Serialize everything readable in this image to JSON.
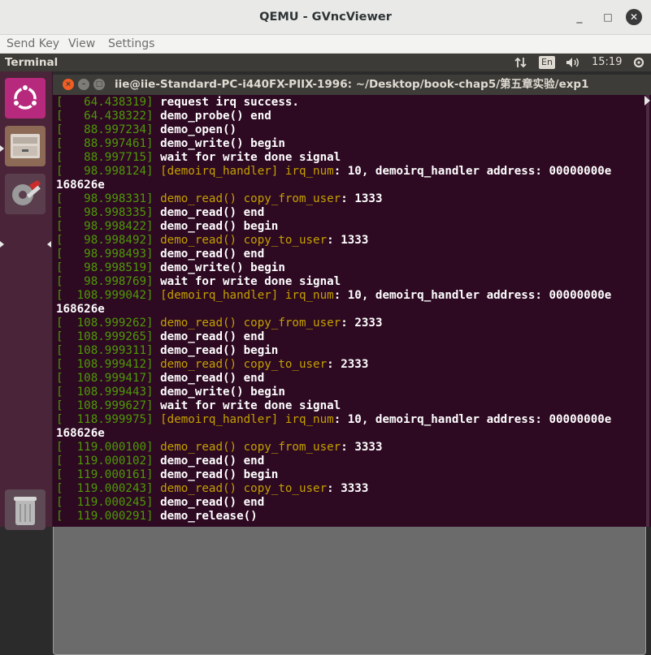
{
  "host": {
    "title": "QEMU - GVncViewer",
    "menu": [
      "Send Key",
      "View",
      "Settings"
    ],
    "controls": {
      "minimize": "_",
      "maximize": "□",
      "close": "✕"
    }
  },
  "panel": {
    "app_name": "Terminal",
    "language": "En",
    "time": "15:19",
    "icons": [
      "network-updown-icon",
      "volume-icon",
      "power-gear-icon"
    ]
  },
  "launcher": {
    "items": [
      "ubuntu-dash-icon",
      "files-icon",
      "system-settings-icon",
      "terminal-icon",
      "trash-icon"
    ]
  },
  "terminal": {
    "title": "iie@iie-Standard-PC-i440FX-PIIX-1996: ~/Desktop/book-chap5/第五章实验/exp1",
    "lines": [
      {
        "ts": "   64.438319",
        "parts": [
          {
            "t": "request irq success.",
            "c": "w"
          }
        ]
      },
      {
        "ts": "   64.438322",
        "parts": [
          {
            "t": "demo_probe() end",
            "c": "w"
          }
        ]
      },
      {
        "ts": "   88.997234",
        "parts": [
          {
            "t": "demo_open()",
            "c": "w"
          }
        ]
      },
      {
        "ts": "   88.997461",
        "parts": [
          {
            "t": "demo_write() begin",
            "c": "w"
          }
        ]
      },
      {
        "ts": "   88.997715",
        "parts": [
          {
            "t": "wait for write done signal",
            "c": "w"
          }
        ]
      },
      {
        "ts": "   98.998124",
        "parts": [
          {
            "t": "[demoirq_handler] irq_num",
            "c": "y"
          },
          {
            "t": ": 10, demoirq_handler address: 00000000e",
            "c": "w"
          }
        ]
      },
      {
        "cont": "168626e"
      },
      {
        "ts": "   98.998331",
        "parts": [
          {
            "t": "demo_read() copy_from_user",
            "c": "y"
          },
          {
            "t": ": 1333",
            "c": "w"
          }
        ]
      },
      {
        "ts": "   98.998335",
        "parts": [
          {
            "t": "demo_read() end",
            "c": "w"
          }
        ]
      },
      {
        "ts": "   98.998422",
        "parts": [
          {
            "t": "demo_read() begin",
            "c": "w"
          }
        ]
      },
      {
        "ts": "   98.998492",
        "parts": [
          {
            "t": "demo_read() copy_to_user",
            "c": "y"
          },
          {
            "t": ": 1333",
            "c": "w"
          }
        ]
      },
      {
        "ts": "   98.998493",
        "parts": [
          {
            "t": "demo_read() end",
            "c": "w"
          }
        ]
      },
      {
        "ts": "   98.998519",
        "parts": [
          {
            "t": "demo_write() begin",
            "c": "w"
          }
        ]
      },
      {
        "ts": "   98.998769",
        "parts": [
          {
            "t": "wait for write done signal",
            "c": "w"
          }
        ]
      },
      {
        "ts": "  108.999042",
        "parts": [
          {
            "t": "[demoirq_handler] irq_num",
            "c": "y"
          },
          {
            "t": ": 10, demoirq_handler address: 00000000e",
            "c": "w"
          }
        ]
      },
      {
        "cont": "168626e"
      },
      {
        "ts": "  108.999262",
        "parts": [
          {
            "t": "demo_read() copy_from_user",
            "c": "y"
          },
          {
            "t": ": 2333",
            "c": "w"
          }
        ]
      },
      {
        "ts": "  108.999265",
        "parts": [
          {
            "t": "demo_read() end",
            "c": "w"
          }
        ]
      },
      {
        "ts": "  108.999311",
        "parts": [
          {
            "t": "demo_read() begin",
            "c": "w"
          }
        ]
      },
      {
        "ts": "  108.999412",
        "parts": [
          {
            "t": "demo_read() copy_to_user",
            "c": "y"
          },
          {
            "t": ": 2333",
            "c": "w"
          }
        ]
      },
      {
        "ts": "  108.999417",
        "parts": [
          {
            "t": "demo_read() end",
            "c": "w"
          }
        ]
      },
      {
        "ts": "  108.999443",
        "parts": [
          {
            "t": "demo_write() begin",
            "c": "w"
          }
        ]
      },
      {
        "ts": "  108.999627",
        "parts": [
          {
            "t": "wait for write done signal",
            "c": "w"
          }
        ]
      },
      {
        "ts": "  118.999975",
        "parts": [
          {
            "t": "[demoirq_handler] irq_num",
            "c": "y"
          },
          {
            "t": ": 10, demoirq_handler address: 00000000e",
            "c": "w"
          }
        ]
      },
      {
        "cont": "168626e"
      },
      {
        "ts": "  119.000100",
        "parts": [
          {
            "t": "demo_read() copy_from_user",
            "c": "y"
          },
          {
            "t": ": 3333",
            "c": "w"
          }
        ]
      },
      {
        "ts": "  119.000102",
        "parts": [
          {
            "t": "demo_read() end",
            "c": "w"
          }
        ]
      },
      {
        "ts": "  119.000161",
        "parts": [
          {
            "t": "demo_read() begin",
            "c": "w"
          }
        ]
      },
      {
        "ts": "  119.000243",
        "parts": [
          {
            "t": "demo_read() copy_to_user",
            "c": "y"
          },
          {
            "t": ": 3333",
            "c": "w"
          }
        ]
      },
      {
        "ts": "  119.000245",
        "parts": [
          {
            "t": "demo_read() end",
            "c": "w"
          }
        ]
      },
      {
        "ts": "  119.000291",
        "parts": [
          {
            "t": "demo_release()",
            "c": "w"
          }
        ]
      }
    ]
  },
  "colors": {
    "terminal_bg": "#2d0922",
    "timestamp_green": "#4e9a06",
    "highlight_yellow": "#c4a000",
    "launcher_bg": "#4a2438",
    "close_orange": "#f15d22"
  }
}
